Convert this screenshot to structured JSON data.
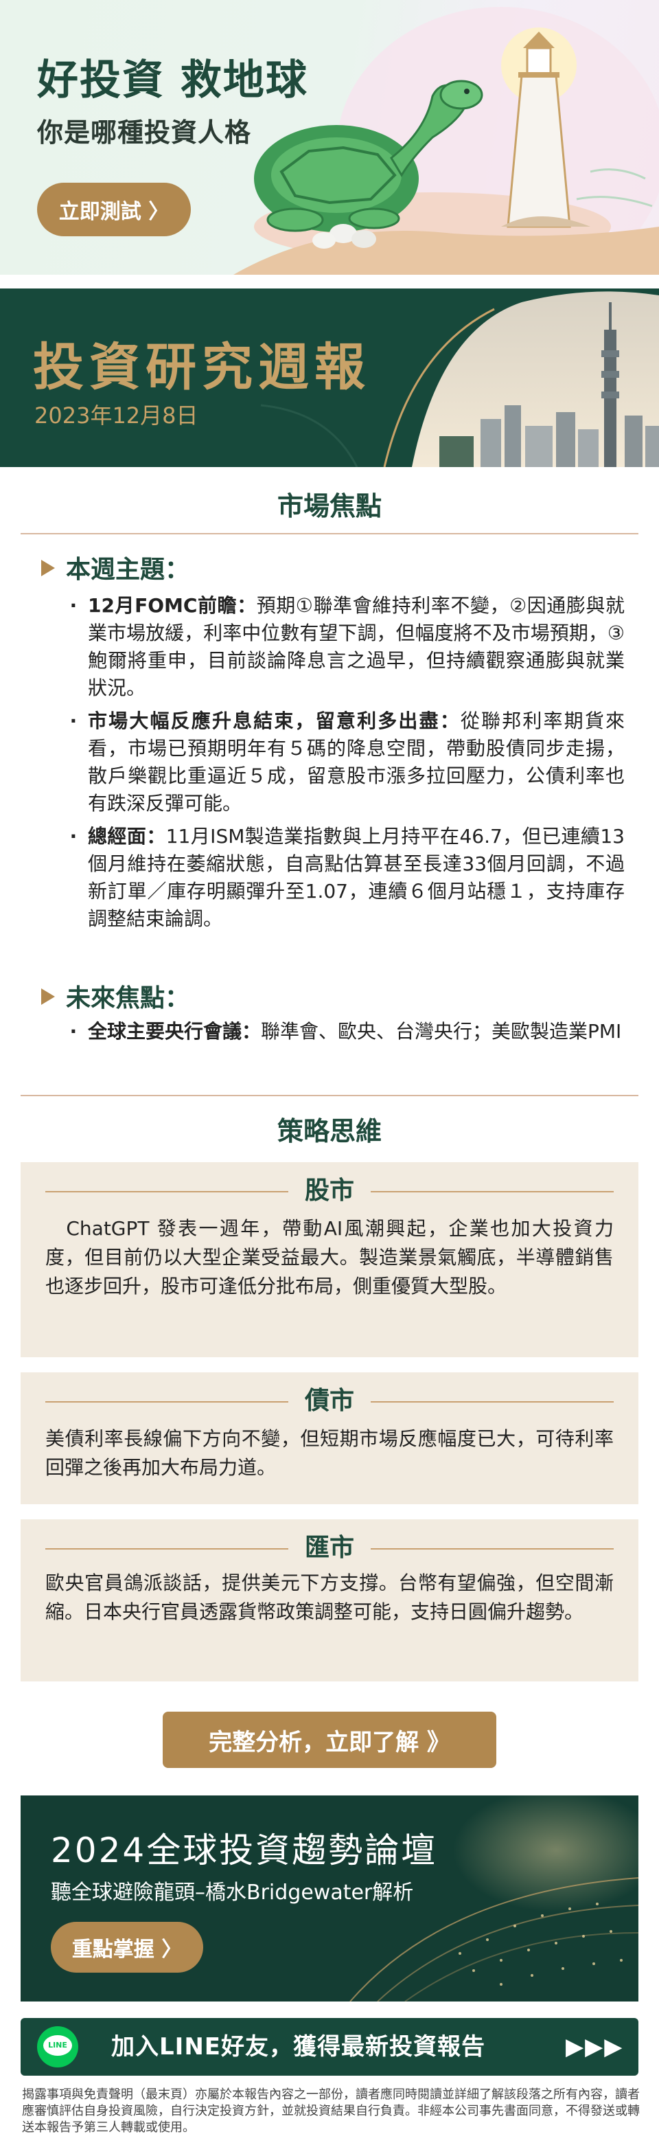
{
  "hero": {
    "title": "好投資 救地球",
    "subtitle": "你是哪種投資人格",
    "button_label": "立即測試 〉"
  },
  "report": {
    "title": "投資研究週報",
    "date": "2023年12月8日"
  },
  "market_focus": {
    "heading": "市場焦點",
    "this_week": {
      "title": "本週主題：",
      "items": [
        {
          "lead": "12月FOMC前瞻：",
          "text": "預期①聯準會維持利率不變，②因通膨與就業市場放緩，利率中位數有望下調，但幅度將不及市場預期，③鮑爾將重申，目前談論降息言之過早，但持續觀察通膨與就業狀況。"
        },
        {
          "lead": "市場大幅反應升息結束，留意利多出盡：",
          "text": "從聯邦利率期貨來看，市場已預期明年有５碼的降息空間，帶動股債同步走揚，散戶樂觀比重逼近５成，留意股市漲多拉回壓力，公債利率也有跌深反彈可能。"
        },
        {
          "lead": "總經面：",
          "text": "11月ISM製造業指數與上月持平在46.7，但已連續13個月維持在萎縮狀態，自高點估算甚至長達33個月回調，不過新訂單／庫存明顯彈升至1.07，連續６個月站穩１，支持庫存調整結束論調。"
        }
      ]
    },
    "upcoming": {
      "title": "未來焦點：",
      "items": [
        {
          "lead": "全球主要央行會議：",
          "text": "聯準會、歐央、台灣央行；美歐製造業PMI"
        }
      ]
    }
  },
  "strategy": {
    "heading": "策略思維",
    "boxes": [
      {
        "title": "股市",
        "text": "　ChatGPT 發表一週年，帶動AI風潮興起，企業也加大投資力度，但目前仍以大型企業受益最大。製造業景氣觸底，半導體銷售也逐步回升，股市可逢低分批布局，側重優質大型股。"
      },
      {
        "title": "債市",
        "text": "美債利率長線偏下方向不變，但短期市場反應幅度已大，可待利率回彈之後再加大布局力道。"
      },
      {
        "title": "匯市",
        "text": "歐央官員鴿派談話，提供美元下方支撐。台幣有望偏強，但空間漸縮。日本央行官員透露貨幣政策調整可能，支持日圓偏升趨勢。"
      }
    ]
  },
  "cta": {
    "label": "完整分析，立即了解 》"
  },
  "forum": {
    "title": "2024全球投資趨勢論壇",
    "subtitle": "聽全球避險龍頭–橋水Bridgewater解析",
    "button_label": "重點掌握 〉"
  },
  "line_bar": {
    "icon_text": "LINE",
    "text": "加入LINE好友，獲得最新投資報告",
    "arrows": "▶▶▶"
  },
  "disclaimer": "揭露事項與免責聲明（最末頁）亦屬於本報告內容之一部份，讀者應同時閱讀並詳細了解該段落之所有內容，讀者應審慎評估自身投資風險，自行決定投資方針，並就投資結果自行負責。非經本公司事先書面同意，不得發送或轉送本報告予第三人轉載或使用。",
  "colors": {
    "brand_green": "#17493b",
    "gold": "#b1884f",
    "box_bg": "#f2ebe0",
    "line_green": "#06c755"
  }
}
